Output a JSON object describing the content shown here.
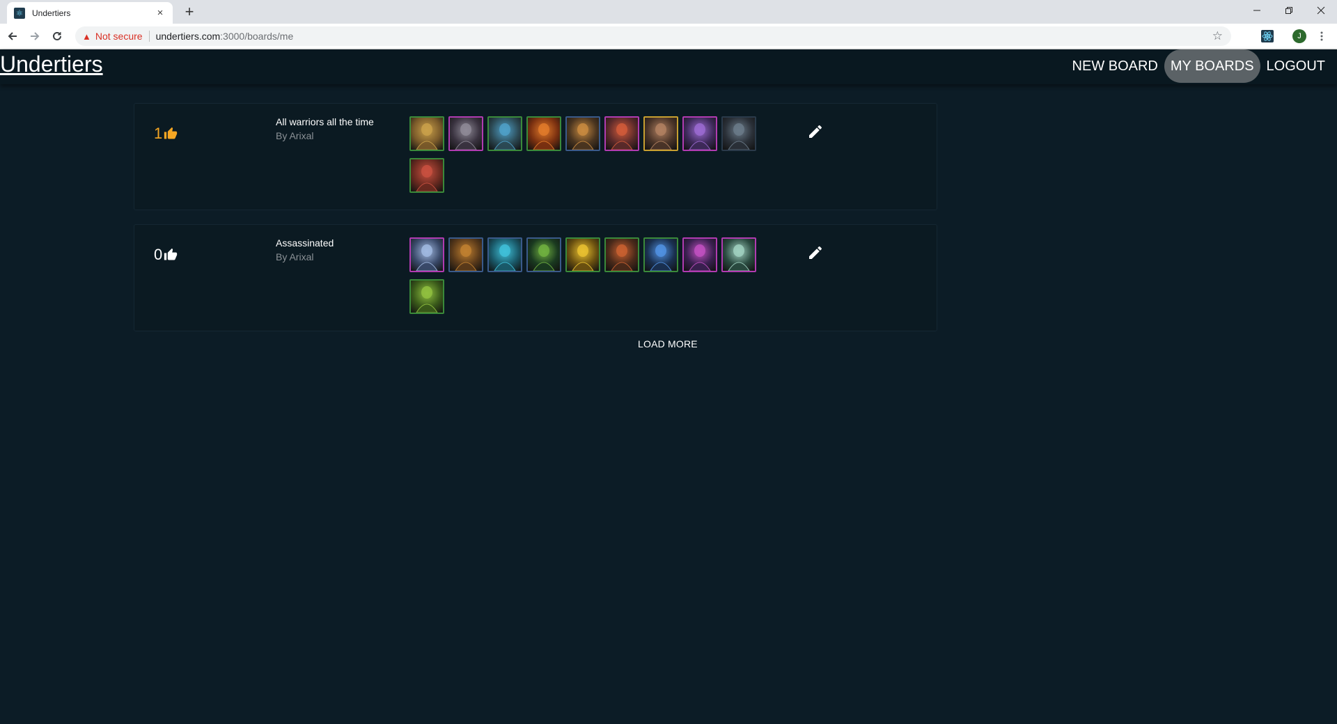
{
  "browser": {
    "tab_title": "Undertiers",
    "tab_close": "×",
    "new_tab": "+",
    "not_secure": "Not secure",
    "url_host": "undertiers.com",
    "url_path": ":3000/boards/me",
    "profile_initial": "J"
  },
  "app": {
    "logo": "Undertiers",
    "nav": [
      {
        "label": "NEW BOARD",
        "active": false
      },
      {
        "label": "MY BOARDS",
        "active": true
      },
      {
        "label": "LOGOUT",
        "active": false
      }
    ]
  },
  "boards": [
    {
      "votes": "1",
      "vote_color": "#f5a623",
      "name": "All warriors all the time",
      "author": "By Arixal",
      "heroes": [
        {
          "border": "#3a8a3a",
          "bg": "#7a5a2a",
          "fg": "#c9a04a"
        },
        {
          "border": "#b13bb1",
          "bg": "#3a3340",
          "fg": "#8e8a96"
        },
        {
          "border": "#3a8a3a",
          "bg": "#2c4a55",
          "fg": "#4fa0c8"
        },
        {
          "border": "#3a8a3a",
          "bg": "#7a3010",
          "fg": "#e07a2a"
        },
        {
          "border": "#3a5a8a",
          "bg": "#4a3520",
          "fg": "#c88a40"
        },
        {
          "border": "#b13bb1",
          "bg": "#5a2a2a",
          "fg": "#d05a3a"
        },
        {
          "border": "#c8a030",
          "bg": "#4a3428",
          "fg": "#b08060"
        },
        {
          "border": "#b13bb1",
          "bg": "#3e2a5a",
          "fg": "#9a6ad0"
        },
        {
          "border": "#2a3a4a",
          "bg": "#2a3038",
          "fg": "#6a7a88"
        },
        {
          "border": "#3a8a3a",
          "bg": "#6a2a20",
          "fg": "#c85040"
        }
      ]
    },
    {
      "votes": "0",
      "vote_color": "#ffffff",
      "name": "Assassinated",
      "author": "By Arixal",
      "heroes": [
        {
          "border": "#b13bb1",
          "bg": "#3a4a6a",
          "fg": "#a0b8e0"
        },
        {
          "border": "#3a5a8a",
          "bg": "#5a3a1a",
          "fg": "#c08030"
        },
        {
          "border": "#3a5a8a",
          "bg": "#1a5a6a",
          "fg": "#40c0d8"
        },
        {
          "border": "#3a5a8a",
          "bg": "#1a3a20",
          "fg": "#70b040"
        },
        {
          "border": "#3a8a3a",
          "bg": "#6a5010",
          "fg": "#e8c030"
        },
        {
          "border": "#3a8a3a",
          "bg": "#4a2a1a",
          "fg": "#c86030"
        },
        {
          "border": "#3a8a3a",
          "bg": "#1a3050",
          "fg": "#5090e0"
        },
        {
          "border": "#b13bb1",
          "bg": "#3a2050",
          "fg": "#c050c0"
        },
        {
          "border": "#b13bb1",
          "bg": "#2a4a40",
          "fg": "#a0d0c0"
        },
        {
          "border": "#3a8a3a",
          "bg": "#3a5a1a",
          "fg": "#90c040"
        }
      ]
    }
  ],
  "load_more": "LOAD MORE"
}
